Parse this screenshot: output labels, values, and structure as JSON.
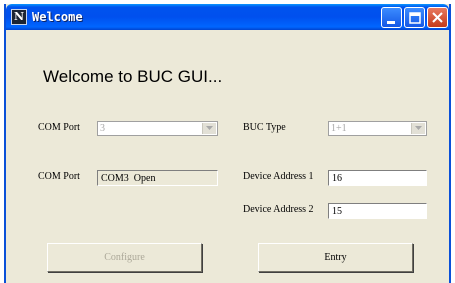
{
  "window": {
    "title": "Welcome",
    "icon": "app-icon"
  },
  "heading": "Welcome to BUC GUI...",
  "left": {
    "com_port_select_label": "COM Port",
    "com_port_select_value": "3",
    "com_port_status_label": "COM Port",
    "com_port_status_value": "COM3  Open"
  },
  "right": {
    "buc_type_label": "BUC Type",
    "buc_type_value": "1+1",
    "device_address_1_label": "Device Address 1",
    "device_address_1_value": "16",
    "device_address_2_label": "Device Address 2",
    "device_address_2_value": "15"
  },
  "buttons": {
    "configure": "Configure",
    "entry": "Entry"
  }
}
